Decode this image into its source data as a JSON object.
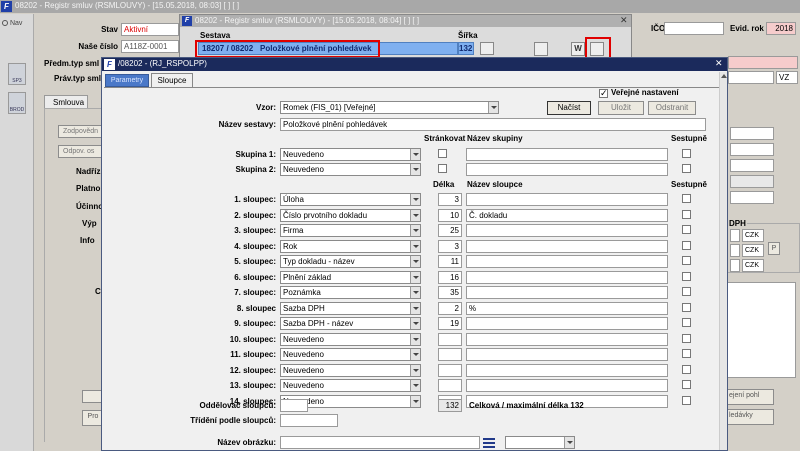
{
  "main_window": {
    "title": "08202 - Registr smluv (RSMLOUVY) - [15.05.2018, 08:03]  [ ]  [ ]",
    "nav_label": "Nav",
    "side_icons": [
      "SP3",
      "BROD"
    ],
    "fields": {
      "stav_label": "Stav",
      "stav_value": "Aktivní",
      "nase_cislo_label": "Naše číslo",
      "nase_cislo_value": "A118Z-0001",
      "predm_label": "Předm.typ sml",
      "prav_label": "Práv.typ sml",
      "ico_label": "IČO",
      "evid_rok_label": "Evid. rok",
      "evid_rok_value": "2018",
      "vz_value": "VZ"
    },
    "tab_smlouva": "Smlouva",
    "left_buttons": [
      "Zodpovědn",
      "Odpov. os"
    ],
    "left_labels": [
      "Nadříz",
      "Platno",
      "Účinno",
      "Výp",
      "Info"
    ],
    "left_other": [
      "C",
      "Pro"
    ],
    "right": {
      "dph_label": "DPH",
      "czk": [
        "CZK",
        "CZK",
        "CZK"
      ],
      "p_btn": "P",
      "btn1": "ejení pohl",
      "btn2": "ledávky"
    }
  },
  "sestava_window": {
    "title": "08202 - Registr smluv (RSMLOUVY) - [15.05.2018, 08:04]  [ ]  [ ]",
    "sestava_label": "Sestava",
    "sestava_code": "18207 / 08202",
    "sestava_name": "Položkové plnění pohledávek",
    "sirka_label": "Šířka",
    "sirka_value": "132",
    "close": "✕"
  },
  "dialog": {
    "title": "/08202 - (RJ_RSPOLPP)",
    "tabs": [
      "Parametry",
      "Sloupce"
    ],
    "verejne_label": "Veřejné nastavení",
    "verejne_checked": "✓",
    "vzor_label": "Vzor:",
    "vzor_value": "Romek   (FIS_01)   [Veřejné]",
    "nacist": "Načíst",
    "ulozit": "Uložit",
    "odstranit": "Odstranit",
    "nazev_sestavy_label": "Název sestavy:",
    "nazev_sestavy_value": "Položkové plnění pohledávek",
    "hdr_strankovat": "Stránkovat",
    "hdr_nazev_skupiny": "Název skupiny",
    "hdr_sestupne": "Sestupně",
    "groups": [
      {
        "label": "Skupina 1:",
        "value": "Neuvedeno"
      },
      {
        "label": "Skupina 2:",
        "value": "Neuvedeno"
      }
    ],
    "hdr_delka": "Délka",
    "hdr_nazev_sloupce": "Název sloupce",
    "hdr_sestupne2": "Sestupně",
    "columns": [
      {
        "label": "1. sloupec:",
        "value": "Úloha",
        "len": "3",
        "name": ""
      },
      {
        "label": "2. sloupec:",
        "value": "Číslo prvotního dokladu",
        "len": "10",
        "name": "Č. dokladu"
      },
      {
        "label": "3. sloupec:",
        "value": "Firma",
        "len": "25",
        "name": ""
      },
      {
        "label": "4. sloupec:",
        "value": "Rok",
        "len": "3",
        "name": ""
      },
      {
        "label": "5. sloupec:",
        "value": "Typ dokladu - název",
        "len": "11",
        "name": ""
      },
      {
        "label": "6. sloupec:",
        "value": "Plnění základ",
        "len": "16",
        "name": ""
      },
      {
        "label": "7. sloupec:",
        "value": "Poznámka",
        "len": "35",
        "name": ""
      },
      {
        "label": "8. sloupec",
        "value": "Sazba DPH",
        "len": "2",
        "name": "%"
      },
      {
        "label": "9. sloupec:",
        "value": "Sazba DPH - název",
        "len": "19",
        "name": ""
      },
      {
        "label": "10. sloupec:",
        "value": "Neuvedeno",
        "len": "",
        "name": ""
      },
      {
        "label": "11. sloupec:",
        "value": "Neuvedeno",
        "len": "",
        "name": ""
      },
      {
        "label": "12. sloupec:",
        "value": "Neuvedeno",
        "len": "",
        "name": ""
      },
      {
        "label": "13. sloupec:",
        "value": "Neuvedeno",
        "len": "",
        "name": ""
      },
      {
        "label": "14. sloupec:",
        "value": "Neuvedeno",
        "len": "",
        "name": ""
      }
    ],
    "oddelovac_label": "Oddělovač sloupců:",
    "celkova_value": "132",
    "celkova_label": "Celková / maximální délka 132",
    "trideni_label": "Třídění podle sloupců:",
    "nazev_obrazku_label": "Název obrázku:"
  }
}
